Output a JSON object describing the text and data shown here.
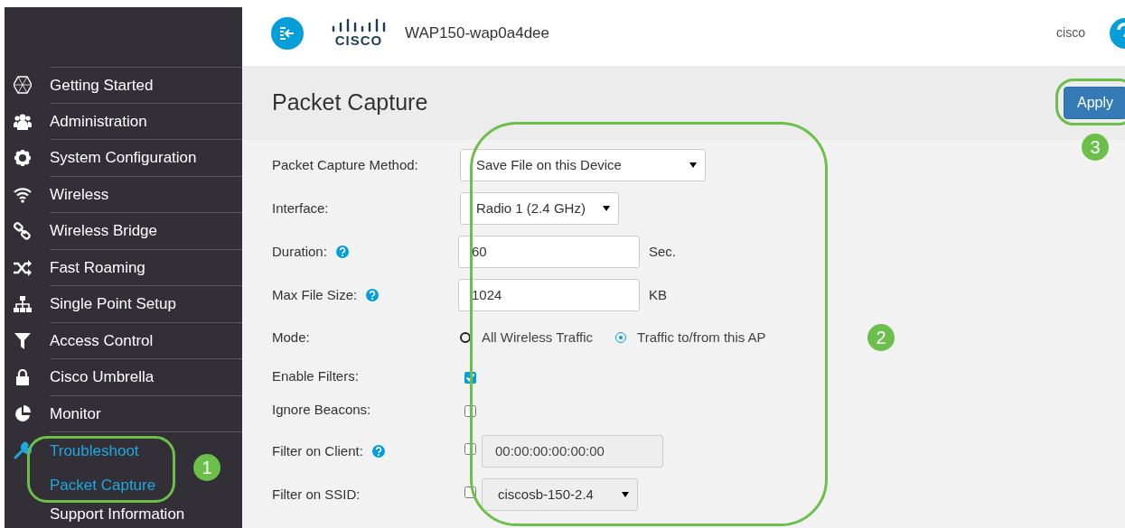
{
  "sidebar": {
    "items": [
      {
        "label": "Getting Started",
        "expanded": false
      },
      {
        "label": "Administration",
        "expanded": false
      },
      {
        "label": "System Configuration",
        "expanded": false
      },
      {
        "label": "Wireless",
        "expanded": false
      },
      {
        "label": "Wireless Bridge",
        "expanded": false
      },
      {
        "label": "Fast Roaming",
        "expanded": false
      },
      {
        "label": "Single Point Setup",
        "expanded": false
      },
      {
        "label": "Access Control",
        "expanded": false
      },
      {
        "label": "Cisco Umbrella",
        "expanded": false
      },
      {
        "label": "Monitor",
        "expanded": false
      },
      {
        "label": "Troubleshoot",
        "expanded": true,
        "children": [
          {
            "label": "Packet Capture",
            "selected": true
          },
          {
            "label": "Support Information",
            "selected": false
          }
        ]
      }
    ]
  },
  "header": {
    "device_name": "WAP150-wap0a4dee",
    "user": "cisco",
    "logo_text": "CISCO"
  },
  "page": {
    "title": "Packet Capture",
    "apply_button": "Apply"
  },
  "form": [
    {
      "kind": "select",
      "label": "Packet Capture Method:",
      "help": false,
      "value": "Save File on this Device"
    },
    {
      "kind": "select",
      "label": "Interface:",
      "help": false,
      "value": "Radio 1 (2.4 GHz)"
    },
    {
      "kind": "text",
      "label": "Duration:",
      "help": true,
      "value": "60",
      "unit": "Sec."
    },
    {
      "kind": "text",
      "label": "Max File Size:",
      "help": true,
      "value": "1024",
      "unit": "KB"
    },
    {
      "kind": "radio",
      "label": "Mode:",
      "help": false,
      "options": [
        {
          "label": "All Wireless Traffic",
          "selected": false
        },
        {
          "label": "Traffic to/from this AP",
          "selected": true
        }
      ]
    },
    {
      "kind": "checkbox",
      "label": "Enable Filters:",
      "help": false,
      "checked": true
    },
    {
      "kind": "checkbox",
      "label": "Ignore Beacons:",
      "help": false,
      "checked": false
    },
    {
      "kind": "checkbox_text",
      "label": "Filter on Client:",
      "help": true,
      "checked": false,
      "value": "00:00:00:00:00:00"
    },
    {
      "kind": "checkbox_select",
      "label": "Filter on SSID:",
      "help": false,
      "checked": false,
      "value": "ciscosb-150-2.4"
    }
  ],
  "annotations": [
    {
      "label": "1"
    },
    {
      "label": "2"
    },
    {
      "label": "3"
    }
  ]
}
